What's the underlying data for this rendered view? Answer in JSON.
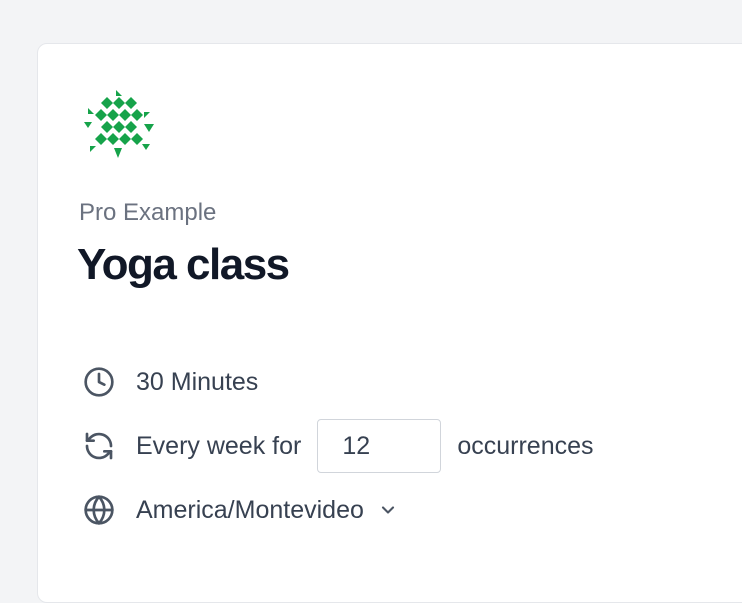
{
  "event": {
    "owner": "Pro Example",
    "title": "Yoga class"
  },
  "details": {
    "duration": "30 Minutes",
    "recurrence_prefix": "Every week for",
    "recurrence_count": "12",
    "recurrence_suffix": "occurrences",
    "timezone": "America/Montevideo"
  },
  "icons": {
    "logo": "green-geometric-logo",
    "duration": "clock-icon",
    "recurrence": "refresh-icon",
    "timezone": "globe-icon",
    "timezone_dropdown": "chevron-down-icon"
  },
  "colors": {
    "logo_green": "#16a34a",
    "title": "#111827",
    "muted": "#6b7280"
  }
}
